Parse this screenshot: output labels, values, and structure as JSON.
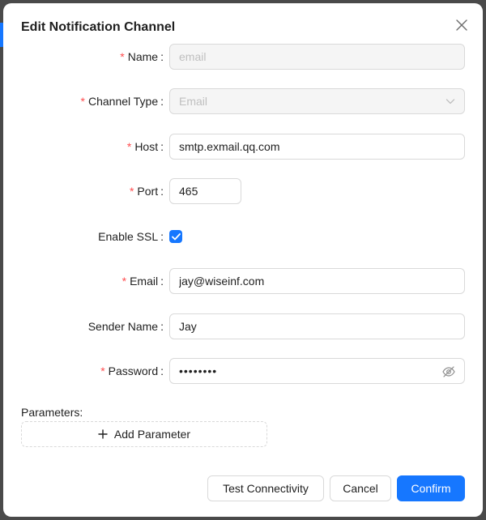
{
  "dialog": {
    "title": "Edit Notification Channel",
    "close_icon": "close-icon"
  },
  "form": {
    "name": {
      "label": "Name",
      "required": true,
      "value": "email",
      "disabled": true
    },
    "channel_type": {
      "label": "Channel Type",
      "required": true,
      "value": "Email",
      "disabled": true,
      "icon": "chevron-down-icon"
    },
    "host": {
      "label": "Host",
      "required": true,
      "value": "smtp.exmail.qq.com"
    },
    "port": {
      "label": "Port",
      "required": true,
      "value": "465"
    },
    "enable_ssl": {
      "label": "Enable SSL",
      "checked": true
    },
    "email": {
      "label": "Email",
      "required": true,
      "value": "jay@wiseinf.com"
    },
    "sender_name": {
      "label": "Sender Name",
      "value": "Jay"
    },
    "password": {
      "label": "Password",
      "required": true,
      "value": "••••••••",
      "icon": "eye-invisible-icon"
    }
  },
  "parameters": {
    "label": "Parameters:",
    "add_label": "Add Parameter",
    "add_icon": "plus-icon"
  },
  "footer": {
    "test_label": "Test Connectivity",
    "cancel_label": "Cancel",
    "confirm_label": "Confirm"
  },
  "colors": {
    "primary": "#1677ff",
    "required": "#ff4d4f",
    "disabled_bg": "#f5f5f5",
    "border": "#d9d9d9"
  }
}
